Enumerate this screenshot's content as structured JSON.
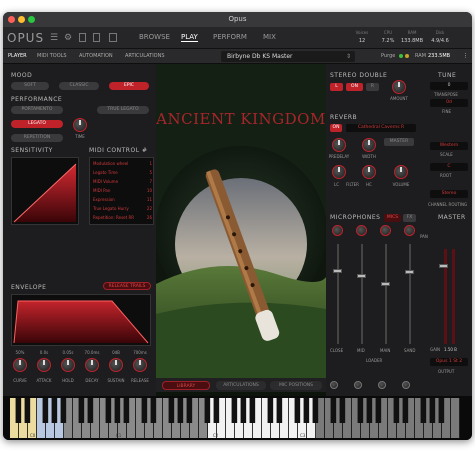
{
  "window": {
    "title": "Opus"
  },
  "topbar": {
    "logo": "OPUS",
    "tabs": [
      "BROWSE",
      "PLAY",
      "PERFORM",
      "MIX"
    ],
    "active_tab": "PLAY",
    "stats": [
      {
        "label": "Voices",
        "value": "12"
      },
      {
        "label": "CPU",
        "value": "7.2%"
      },
      {
        "label": "RAM",
        "value": "133.8MB"
      },
      {
        "label": "Disk",
        "value": "4.9/4.6"
      }
    ]
  },
  "subbar": {
    "tabs": [
      "PLAYER",
      "MIDI TOOLS",
      "AUTOMATION",
      "ARTICULATIONS"
    ],
    "preset": "Birbyne Db KS Master",
    "purge": "Purge",
    "ram_label": "RAM",
    "ram_value": "233.5MB"
  },
  "mood": {
    "title": "MOOD",
    "buttons": [
      "SOFT",
      "CLASSIC",
      "EPIC"
    ],
    "selected": "EPIC"
  },
  "performance": {
    "title": "PERFORMANCE",
    "buttons": [
      "PORTAMENTO",
      "TRUE LEGATO",
      "LEGATO",
      "REPETITION"
    ],
    "selected": "LEGATO",
    "knob_label": "TIME"
  },
  "sensitivity": {
    "title": "SENSITIVITY"
  },
  "midi_control": {
    "title": "MIDI CONTROL #",
    "rows": [
      {
        "name": "Modulation wheel",
        "cc": "1"
      },
      {
        "name": "Legato Time",
        "cc": "5"
      },
      {
        "name": "MIDI Volume",
        "cc": "7"
      },
      {
        "name": "MIDI Pan",
        "cc": "10"
      },
      {
        "name": "Expression",
        "cc": "11"
      },
      {
        "name": "True Legato Hurry",
        "cc": "22"
      },
      {
        "name": "Repetition: Reset RR",
        "cc": "26"
      }
    ]
  },
  "envelope": {
    "title": "ENVELOPE",
    "release_trails": "RELEASE TRAILS",
    "values": [
      "50%",
      "0.0s",
      "0.05s",
      "70.0ms",
      "0dB",
      "700ms"
    ],
    "knobs": [
      "CURVE",
      "ATTACK",
      "HOLD",
      "DECAY",
      "SUSTAIN",
      "RELEASE"
    ]
  },
  "artwork": {
    "title": "ANCIENT KINGDOM"
  },
  "bottom_tabs": {
    "tabs": [
      "LIBRARY",
      "ARTICULATIONS",
      "MIC POSITIONS"
    ],
    "active": "LIBRARY"
  },
  "stereo_double": {
    "title": "STEREO DOUBLE",
    "buttons": [
      "L",
      "ON",
      "R"
    ],
    "knob_label": "AMOUNT"
  },
  "tune": {
    "title": "TUNE",
    "transpose_value": "0",
    "transpose_label": "TRANSPOSE",
    "fine_value": "0d",
    "fine_label": "FINE",
    "scale_value": "Western",
    "scale_label": "SCALE",
    "root_value": "C",
    "root_label": "ROOT",
    "routing_value": "Stereo",
    "routing_label": "CHANNEL ROUTING"
  },
  "reverb": {
    "title": "REVERB",
    "on_label": "ON",
    "preset": "Cathedral Caverns R",
    "master_label": "MASTER",
    "knobs": [
      "PREDELAY",
      "WIDTH",
      "VOLUME"
    ],
    "filter_labels": [
      "LC",
      "FILTER",
      "HC"
    ]
  },
  "microphones": {
    "title": "MICROPHONES",
    "mics_label": "MICS",
    "fx_label": "FX",
    "pan_label": "PAN",
    "channels": [
      "CLOSE",
      "MID",
      "MAIN",
      "SAND"
    ],
    "loader_label": "LOADER"
  },
  "master": {
    "title": "MASTER",
    "gain_label": "GAIN",
    "gain_value": "1.50 B",
    "output_value": "Opus 1 St 2",
    "output_label": "OUTPUT"
  },
  "keyboard": {
    "octave_labels": [
      "C0",
      "C1",
      "C2",
      "C3"
    ]
  },
  "colors": {
    "accent": "#c0222a",
    "panel": "#1d1d1f"
  }
}
